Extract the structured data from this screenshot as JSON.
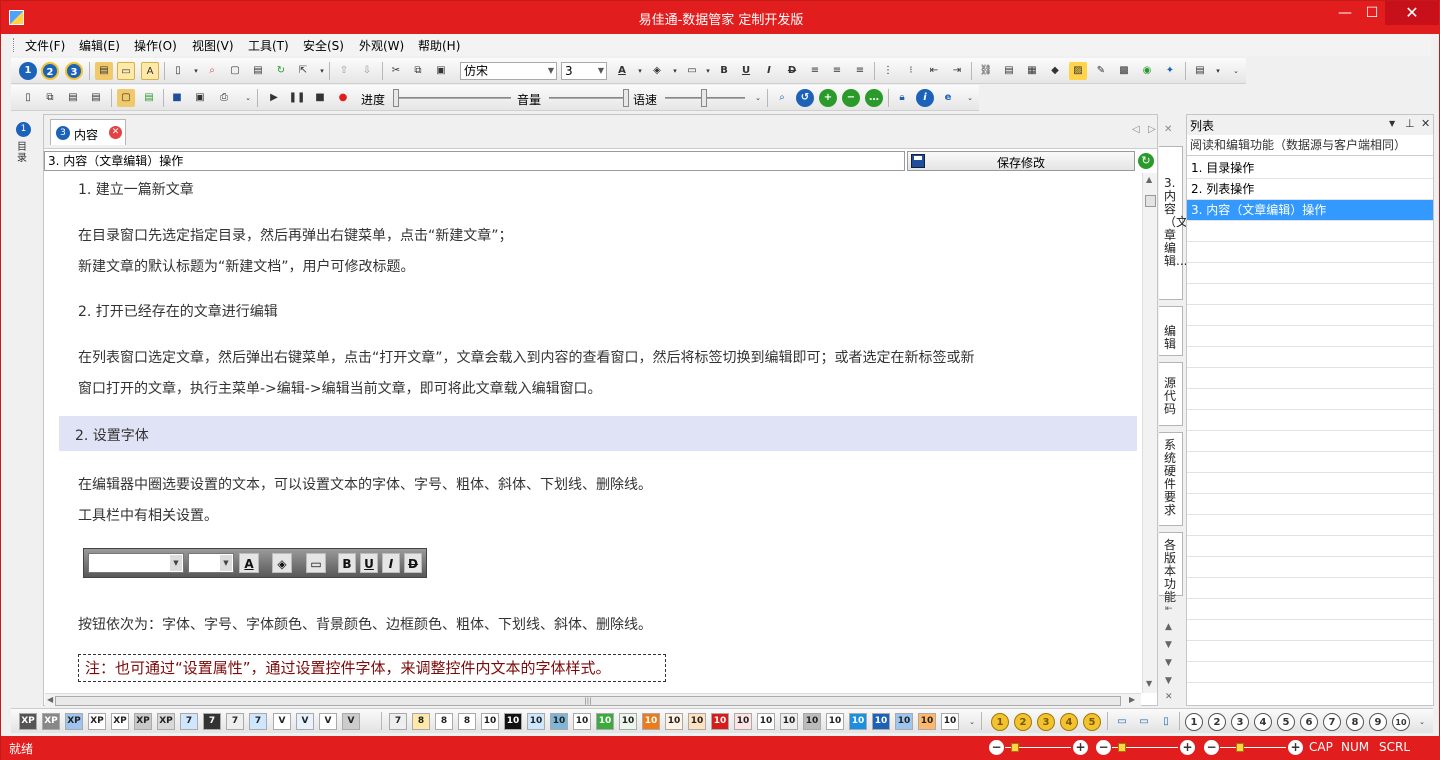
{
  "window": {
    "title": "易佳通-数据管家 定制开发版",
    "controls": {
      "minimize": "—",
      "maximize": "☐",
      "close": "✕"
    }
  },
  "menubar": {
    "items": [
      "文件(F)",
      "编辑(E)",
      "操作(O)",
      "视图(V)",
      "工具(T)",
      "安全(S)",
      "外观(W)",
      "帮助(H)"
    ]
  },
  "toolbar1": {
    "font_name": "仿宋",
    "font_size": "3"
  },
  "toolbar2": {
    "progress_label": "进度",
    "volume_label": "音量",
    "speed_label": "语速"
  },
  "left_strip": {
    "number": "1",
    "label": "目录"
  },
  "editor": {
    "tab": {
      "number": "3",
      "label": "内容"
    },
    "title_value": "3. 内容（文章编辑）操作",
    "save_label": "保存修改",
    "paragraphs": {
      "h1": "1.  建立一篇新文章",
      "p1a": "在目录窗口先选定指定目录，然后再弹出右键菜单，点击“新建文章”；",
      "p1b": "新建文章的默认标题为“新建文档”，用户可修改标题。",
      "h2": "2.  打开已经存在的文章进行编辑",
      "p2a": "在列表窗口选定文章，然后弹出右键菜单，点击“打开文章”，文章会载入到内容的查看窗口，然后将标签切换到编辑即可；或者选定在新标签或新",
      "p2b": "窗口打开的文章，执行主菜单->编辑->编辑当前文章，即可将此文章载入编辑窗口。",
      "h3": "2.  设置字体",
      "p3a": "在编辑器中圈选要设置的文本，可以设置文本的字体、字号、粗体、斜体、下划线、删除线。",
      "p3b": "工具栏中有相关设置。",
      "p4": "按钮依次为：字体、字号、字体颜色、背景颜色、边框颜色、粗体、下划线、斜体、删除线。",
      "note": "注：也可通过“设置属性”，通过设置控件字体，来调整控件内文本的字体样式。"
    },
    "sample_toolbar": {
      "bold": "B",
      "underline": "U",
      "italic": "I",
      "strike": "D",
      "font_color": "A"
    }
  },
  "vertical_tabs": [
    "3. 内容（文章编辑...",
    "编辑",
    "源代码",
    "系统硬件要求",
    "各版本功能"
  ],
  "right_panel": {
    "title": "列表",
    "subtitle": "阅读和编辑功能（数据源与客户端相同）",
    "items": [
      {
        "label": "1.  目录操作",
        "selected": false
      },
      {
        "label": "2.  列表操作",
        "selected": false
      },
      {
        "label": "3.  内容（文章编辑）操作",
        "selected": true
      }
    ]
  },
  "bottom_toolbar": {
    "style_buttons": [
      "XP",
      "XP",
      "XP",
      "XP",
      "XP",
      "XP",
      "XP",
      "7",
      "7",
      "7",
      "7",
      "V",
      "V",
      "V",
      "V"
    ],
    "size_buttons": [
      "7",
      "8",
      "8",
      "8",
      "10",
      "10",
      "10",
      "10",
      "10",
      "10",
      "10",
      "10",
      "10",
      "10",
      "10",
      "10",
      "10",
      "10",
      "10",
      "10",
      "10",
      "10",
      "10",
      "10",
      "10",
      "10"
    ],
    "circle_nums_a": [
      "1",
      "2",
      "3",
      "4",
      "5"
    ],
    "circle_nums_b": [
      "1",
      "2",
      "3",
      "4",
      "5",
      "6",
      "7",
      "8",
      "9",
      "10"
    ]
  },
  "statusbar": {
    "text": "就绪",
    "indicators": [
      "CAP",
      "NUM",
      "SCRL"
    ]
  }
}
